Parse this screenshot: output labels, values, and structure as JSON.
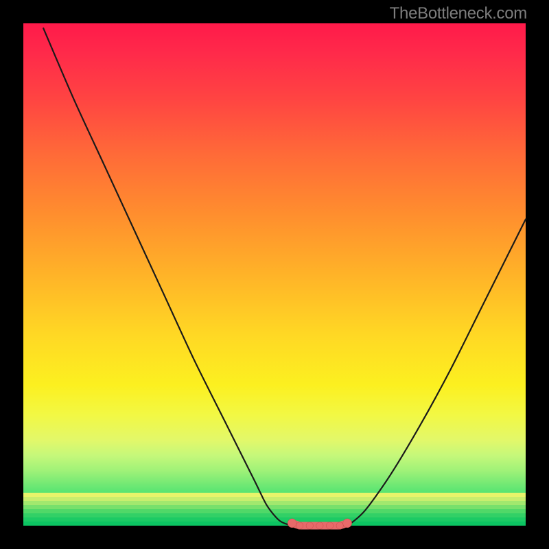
{
  "watermark": "TheBottleneck.com",
  "colors": {
    "frame": "#000000",
    "curve_stroke": "#1a1a1a",
    "marker_fill": "#e86a6a",
    "marker_stroke": "#c84a4a"
  },
  "chart_data": {
    "type": "line",
    "title": "",
    "xlabel": "",
    "ylabel": "",
    "xlim": [
      0,
      100
    ],
    "ylim": [
      0,
      100
    ],
    "grid": false,
    "series": [
      {
        "name": "left-branch",
        "x": [
          4,
          10,
          16,
          22,
          28,
          34,
          40,
          46,
          48.5,
          51,
          53.5
        ],
        "y": [
          99,
          85,
          72,
          59,
          46,
          33,
          21,
          9,
          4,
          1,
          0
        ]
      },
      {
        "name": "plateau",
        "x": [
          53.5,
          55,
          57,
          59,
          61,
          63,
          64.5
        ],
        "y": [
          0,
          0,
          0,
          0,
          0,
          0,
          0
        ]
      },
      {
        "name": "right-branch",
        "x": [
          64.5,
          68,
          73,
          79,
          85,
          91,
          97,
          100
        ],
        "y": [
          0,
          3,
          10,
          20,
          31,
          43,
          55,
          61
        ]
      }
    ],
    "markers": {
      "name": "selected-range",
      "x": [
        53.5,
        55,
        57,
        59,
        61,
        63,
        64.5
      ],
      "y": [
        0.5,
        0,
        0,
        0,
        0,
        0,
        0.5
      ]
    },
    "background_gradient": "red-yellow-green vertical heatmap"
  }
}
